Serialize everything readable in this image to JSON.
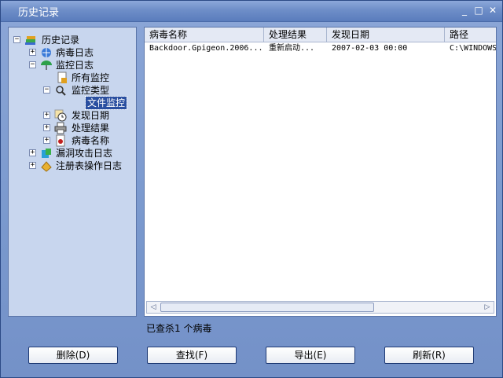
{
  "window": {
    "title": "历史记录",
    "controls": [
      "_",
      "□",
      "✕"
    ]
  },
  "tree": {
    "root": "历史记录",
    "nodes": [
      {
        "label": "病毒日志",
        "expander": "+"
      },
      {
        "label": "监控日志",
        "expander": "−"
      },
      {
        "label": "所有监控",
        "expander": ""
      },
      {
        "label": "监控类型",
        "expander": "−"
      },
      {
        "label": "文件监控",
        "expander": ""
      },
      {
        "label": "发现日期",
        "expander": "+"
      },
      {
        "label": "处理结果",
        "expander": "+"
      },
      {
        "label": "病毒名称",
        "expander": "+"
      },
      {
        "label": "漏洞攻击日志",
        "expander": "+"
      },
      {
        "label": "注册表操作日志",
        "expander": "+"
      }
    ],
    "root_expander": "−"
  },
  "list": {
    "columns": [
      "病毒名称",
      "处理结果",
      "发现日期",
      "路径"
    ],
    "rows": [
      [
        "Backdoor.Gpigeon.2006...",
        "重新启动...",
        "2007-02-03 00:00",
        "C:\\WINDOWS"
      ]
    ],
    "scroll": {
      "left": "◁",
      "right": "▷"
    }
  },
  "status": "已查杀1 个病毒",
  "buttons": {
    "delete": "删除(D)",
    "find": "查找(F)",
    "export": "导出(E)",
    "refresh": "刷新(R)"
  }
}
